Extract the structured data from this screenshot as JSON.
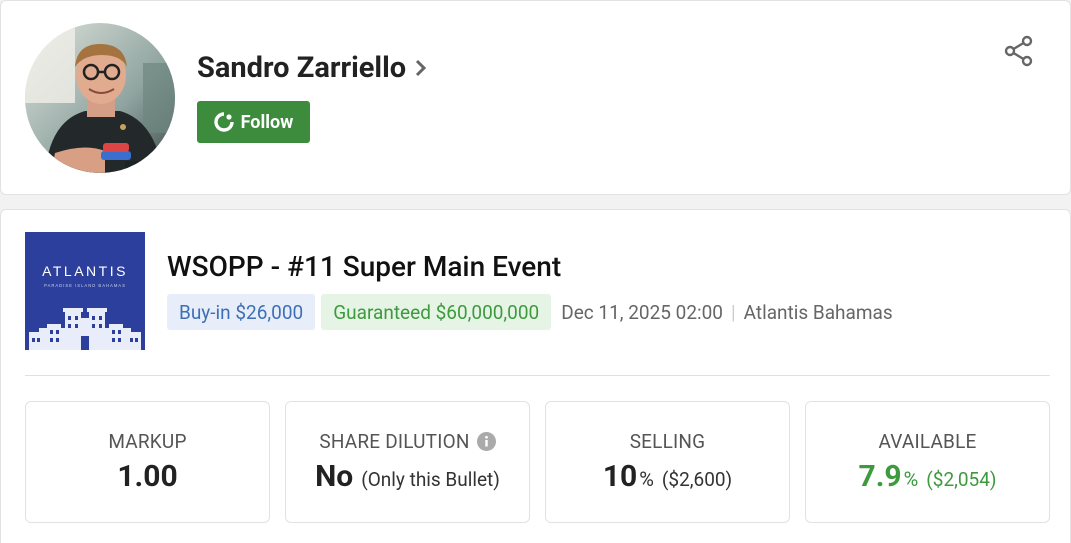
{
  "player": {
    "name": "Sandro Zarriello",
    "follow_label": "Follow"
  },
  "event": {
    "logo_title": "ATLANTIS",
    "logo_subtitle": "PARADISE ISLAND BAHAMAS",
    "title": "WSOPP - #11 Super Main Event",
    "buyin": "Buy-in $26,000",
    "guaranteed": "Guaranteed $60,000,000",
    "datetime": "Dec 11, 2025 02:00",
    "separator": "|",
    "venue": "Atlantis Bahamas"
  },
  "stats": {
    "markup": {
      "label": "MARKUP",
      "value": "1.00"
    },
    "dilution": {
      "label": "SHARE DILUTION",
      "value": "No",
      "sub": "(Only this Bullet)"
    },
    "selling": {
      "label": "SELLING",
      "value": "10",
      "pct": "%",
      "sub": "($2,600)"
    },
    "available": {
      "label": "AVAILABLE",
      "value": "7.9",
      "pct": "%",
      "sub": "($2,054)"
    }
  },
  "colors": {
    "follow_green": "#3d8b3d",
    "buyin_blue": "#3d6fb6",
    "guaranteed_green": "#3d9a3d",
    "logo_blue": "#2c3f9d"
  },
  "icons": {
    "share": "share-icon",
    "follow": "follow-ring-icon",
    "info": "info-icon",
    "chevron": "chevron-right-icon"
  }
}
